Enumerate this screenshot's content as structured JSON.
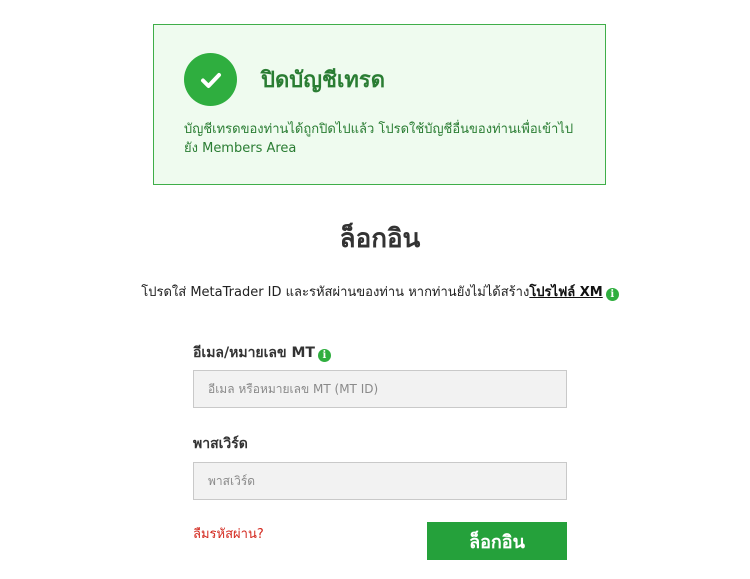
{
  "alert": {
    "icon": "checkmark-icon",
    "title": "ปิดบัญชีเทรด",
    "message": "บัญชีเทรดของท่านได้ถูกปิดไปแล้ว โปรดใช้บัญชีอื่นของท่านเพื่อเข้าไปยัง Members Area"
  },
  "login": {
    "title": "ล็อกอิน",
    "instruction": "โปรดใส่ MetaTrader ID และรหัสผ่านของท่าน หากท่านยังไม่ได้สร้าง",
    "profile_link": "โปรไฟล์ XM",
    "info_icon_glyph": "i",
    "email_label": "อีเมล/หมายเลข MT",
    "email_placeholder": "อีเมล หรือหมายเลข MT (MT ID)",
    "email_value": "",
    "password_label": "พาสเวิร์ด",
    "password_placeholder": "พาสเวิร์ด",
    "password_value": "",
    "forgot_link": "ลืมรหัสผ่าน?",
    "submit_label": "ล็อกอิน"
  },
  "colors": {
    "brand_green": "#25a13b",
    "alert_text": "#2a7d33",
    "alert_bg": "#effbef",
    "link_red": "#d3281e"
  }
}
